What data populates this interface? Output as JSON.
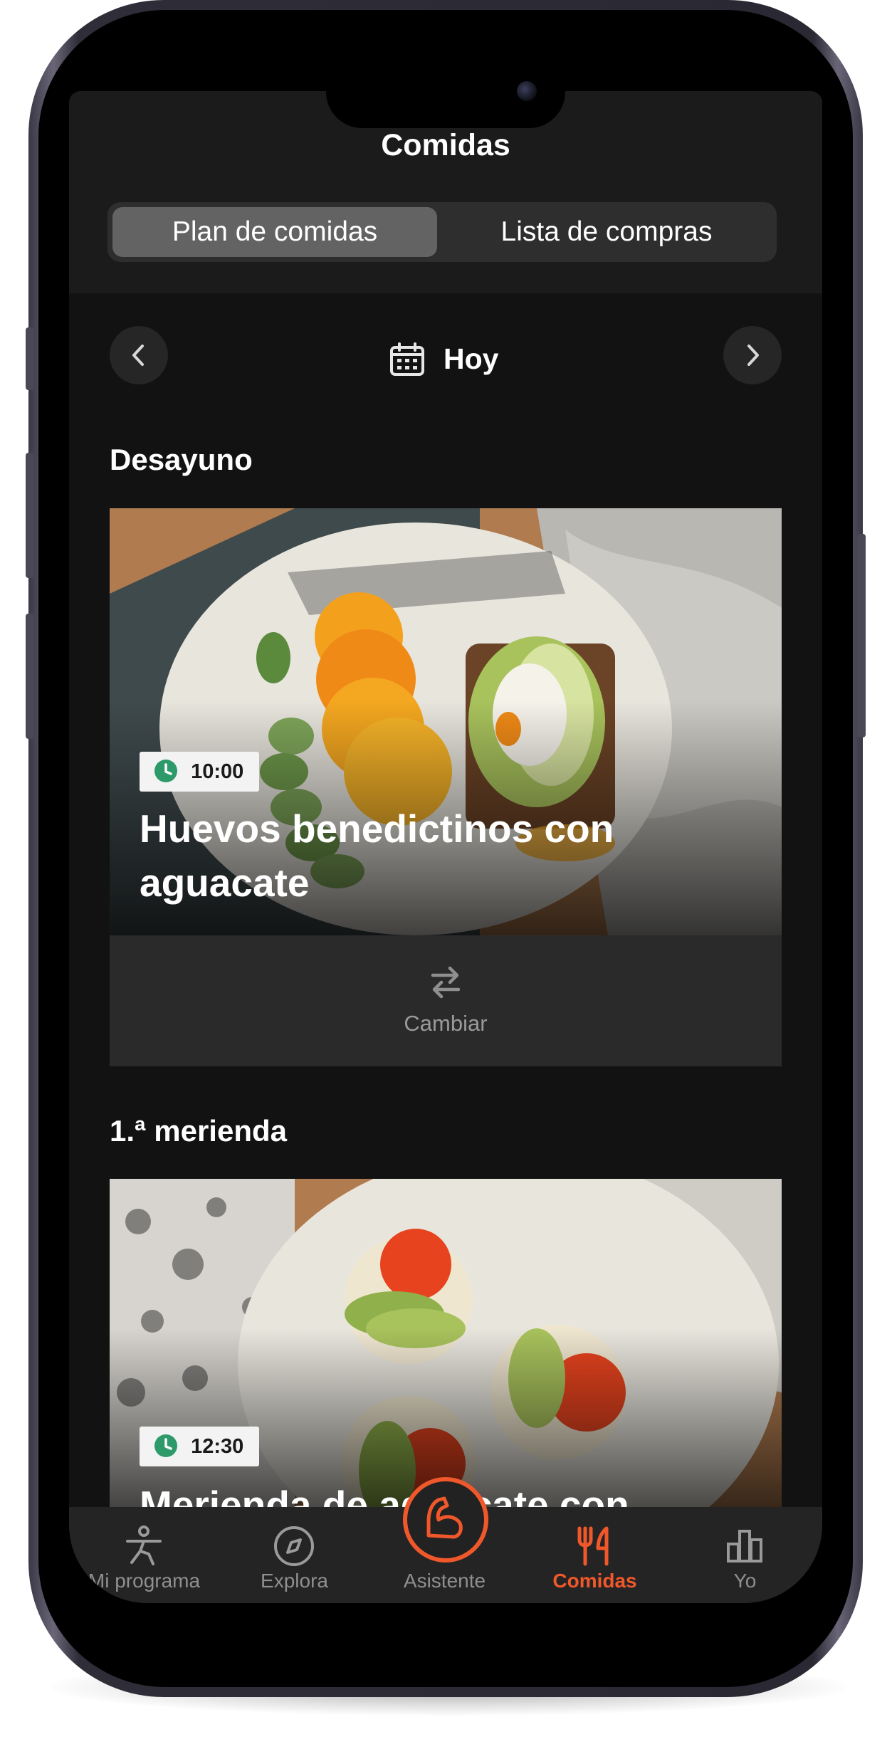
{
  "header": {
    "title": "Comidas",
    "segments": [
      {
        "label": "Plan de comidas",
        "active": true
      },
      {
        "label": "Lista de compras",
        "active": false
      }
    ]
  },
  "date_nav": {
    "label": "Hoy",
    "prev_icon": "chevron-left-icon",
    "next_icon": "chevron-right-icon",
    "calendar_icon": "calendar-icon"
  },
  "meals": [
    {
      "section": "Desayuno",
      "time": "10:00",
      "title": "Huevos benedictinos con aguacate",
      "change_label": "Cambiar"
    },
    {
      "section": "1.ª merienda",
      "time": "12:30",
      "title": "Merienda de aguacate con"
    }
  ],
  "tabbar": {
    "items": [
      {
        "label": "Mi programa",
        "icon": "person-stretch-icon",
        "active": false
      },
      {
        "label": "Explora",
        "icon": "compass-icon",
        "active": false
      },
      {
        "label": "Asistente",
        "icon": "flexed-arm-icon",
        "active": false
      },
      {
        "label": "Comidas",
        "icon": "fork-knife-icon",
        "active": true
      },
      {
        "label": "Yo",
        "icon": "bar-chart-icon",
        "active": false
      }
    ]
  },
  "colors": {
    "accent": "#f0582b",
    "background": "#121212",
    "header_bg": "#1b1b1b",
    "clock_badge_icon": "#2e9a6a"
  }
}
